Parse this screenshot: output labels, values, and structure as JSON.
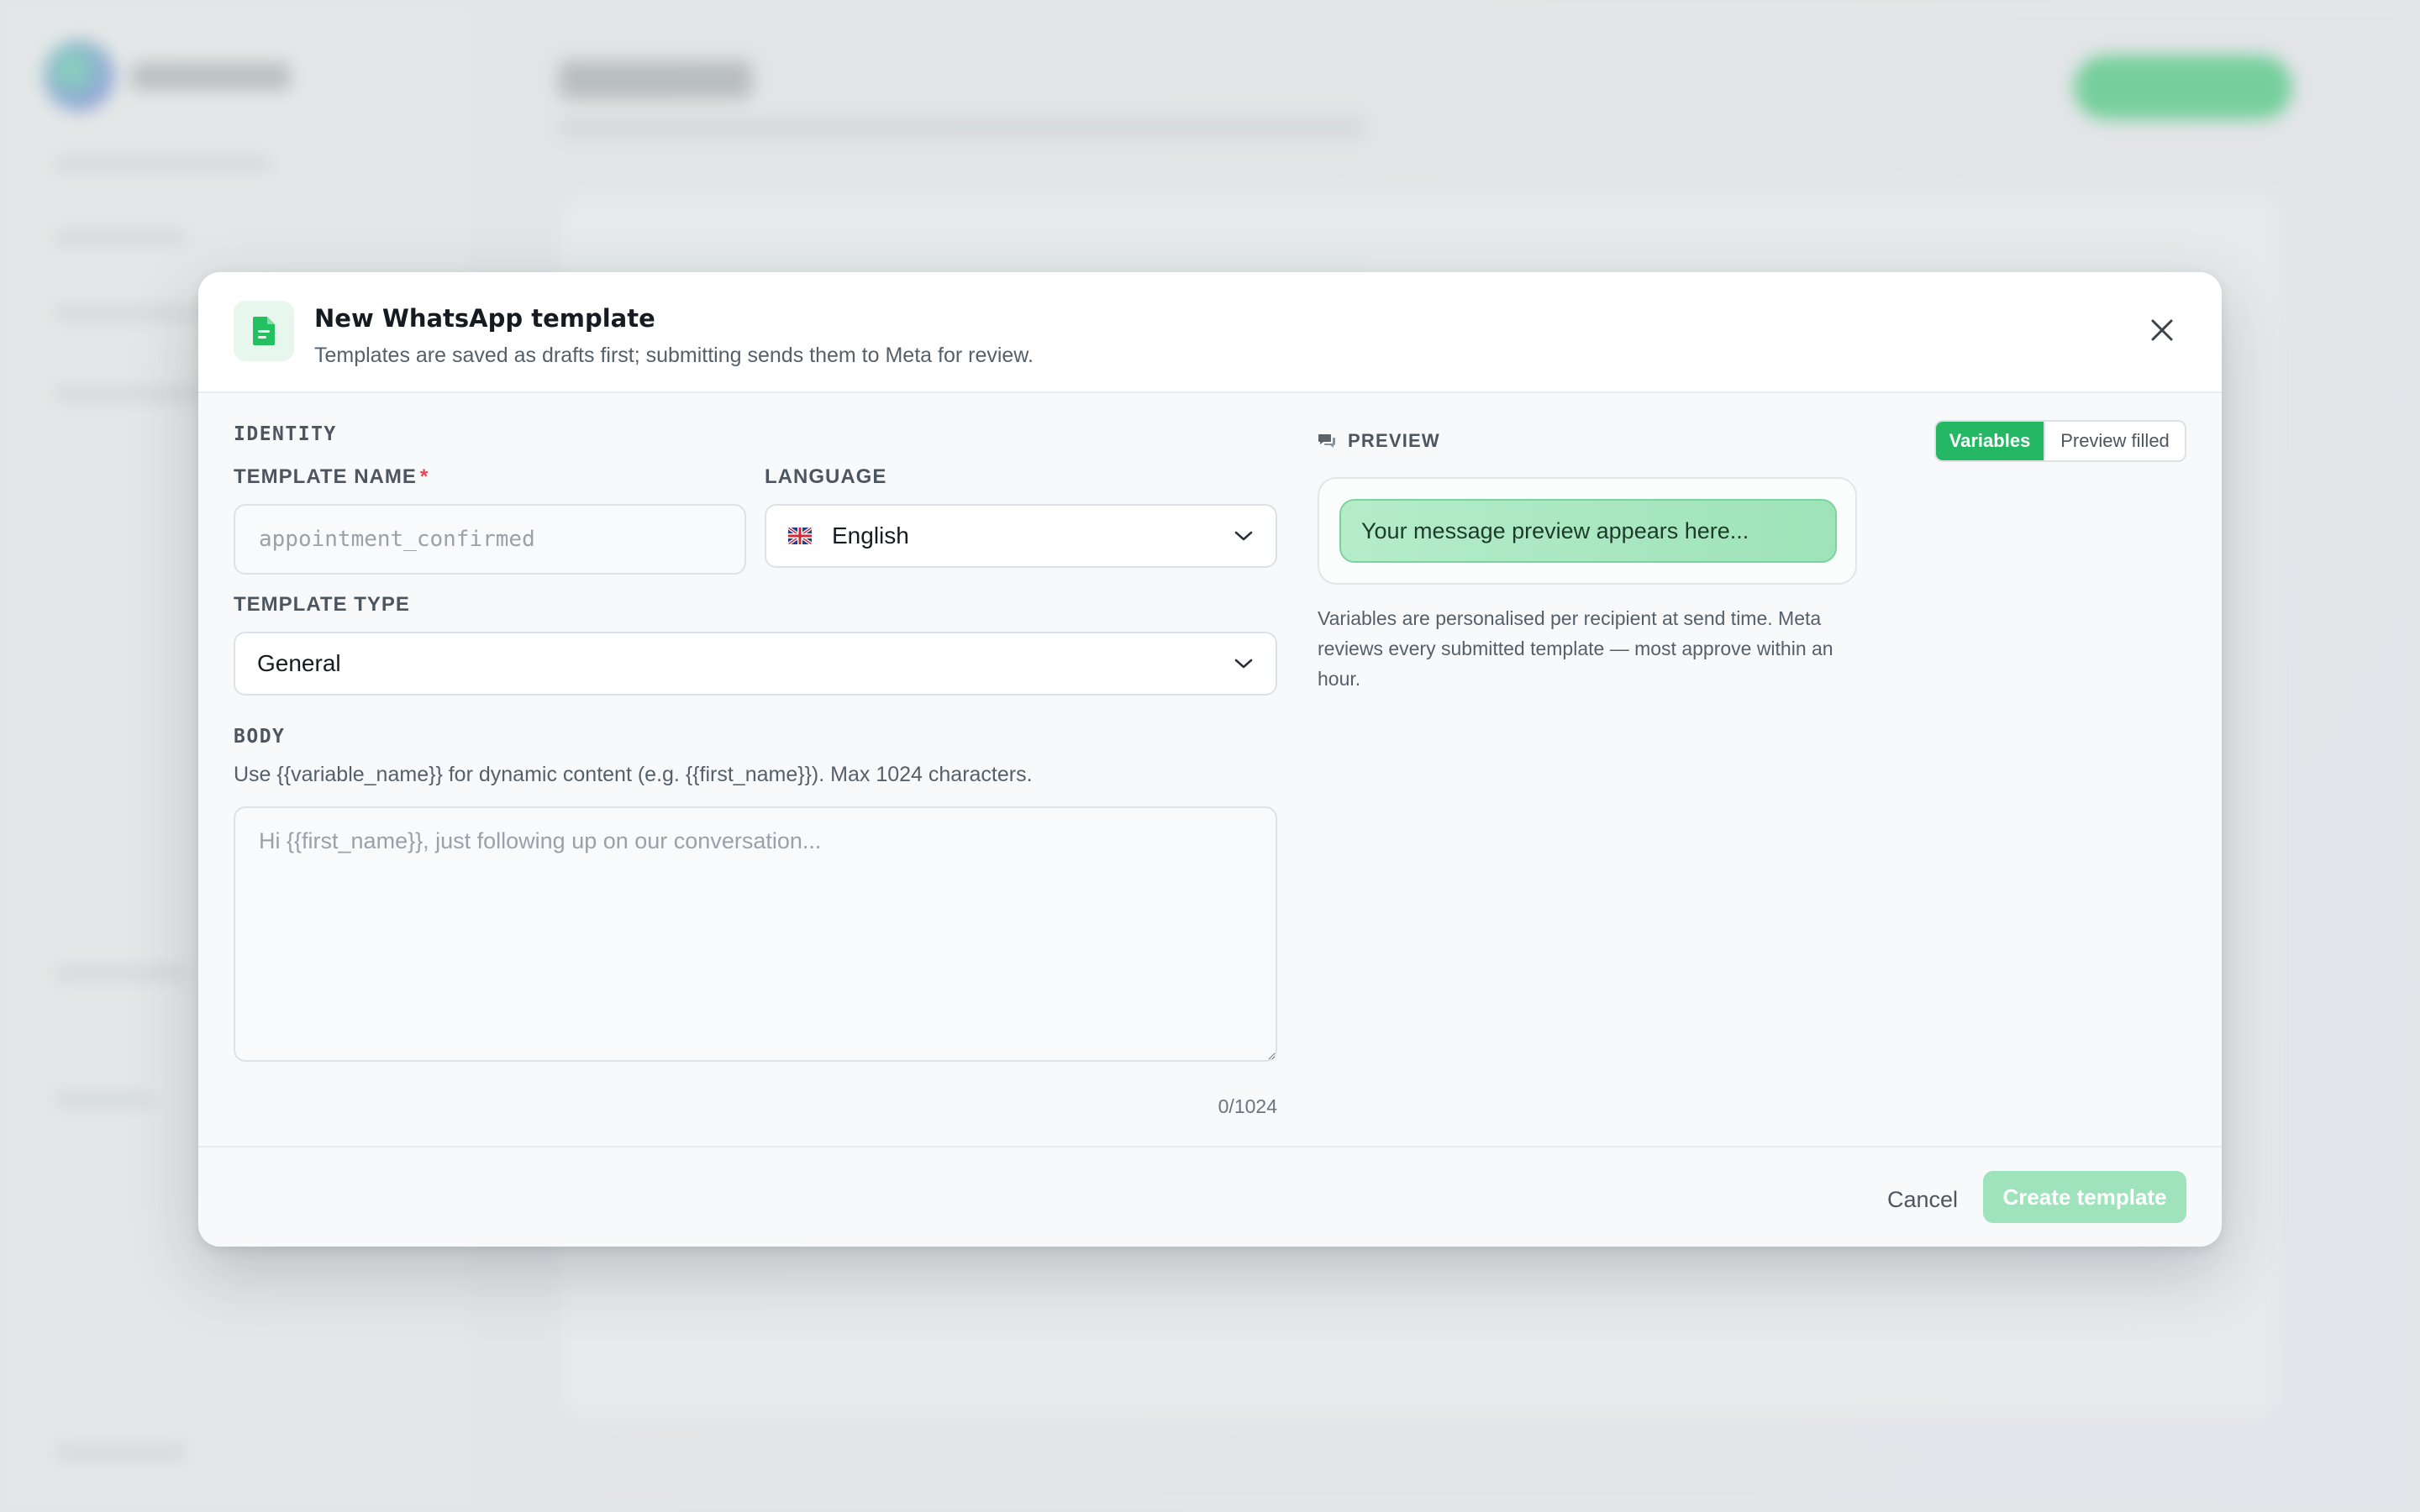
{
  "modal": {
    "title": "New WhatsApp template",
    "subtitle": "Templates are saved as drafts first; submitting sends them to Meta for review.",
    "header_icon": "document-icon",
    "close_icon": "close-icon"
  },
  "form": {
    "identity_label": "IDENTITY",
    "template_name": {
      "label": "TEMPLATE NAME",
      "required_marker": "*",
      "value": "",
      "placeholder": "appointment_confirmed"
    },
    "language": {
      "label": "LANGUAGE",
      "value": "English",
      "flag_icon": "uk-flag-icon"
    },
    "template_type": {
      "label": "TEMPLATE TYPE",
      "value": "General"
    },
    "body": {
      "label": "BODY",
      "help": "Use {{variable_name}} for dynamic content (e.g. {{first_name}}). Max 1024 characters.",
      "value": "",
      "placeholder": "Hi {{first_name}}, just following up on our conversation...",
      "char_count": "0/1024"
    }
  },
  "preview": {
    "label": "PREVIEW",
    "icon": "chat-bubbles-icon",
    "tabs": [
      {
        "label": "Variables",
        "active": true
      },
      {
        "label": "Preview filled",
        "active": false
      }
    ],
    "bubble_text": "Your message preview appears here...",
    "note": "Variables are personalised per recipient at send time. Meta reviews every submitted template — most approve within an hour."
  },
  "footer": {
    "cancel_label": "Cancel",
    "create_label": "Create template"
  },
  "colors": {
    "accent": "#25b864",
    "accent_disabled": "#9fe3bc",
    "required": "#e5484d"
  }
}
